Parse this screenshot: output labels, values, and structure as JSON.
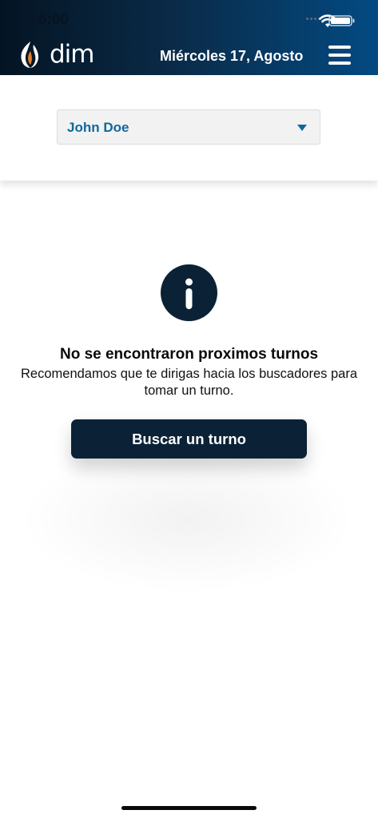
{
  "status_bar": {
    "time": "6:00"
  },
  "header": {
    "logo_text": "dim",
    "date": "Miércoles 17, Agosto"
  },
  "patient_selector": {
    "selected": "John Doe"
  },
  "empty_state": {
    "title": "No se encontraron proximos turnos",
    "message_line1": "Recomendamos que te dirigas hacia los buscadores para",
    "message_line2": "tomar un turno."
  },
  "actions": {
    "search_label": "Buscar un turno"
  },
  "icons": [
    "wifi-icon",
    "battery-icon",
    "logo-flame-icon",
    "menu-icon",
    "dropdown-icon",
    "info-icon"
  ],
  "colors": {
    "header_start": "#041423",
    "header_end": "#034a82",
    "accent": "#10679e",
    "button": "#0b2236"
  }
}
